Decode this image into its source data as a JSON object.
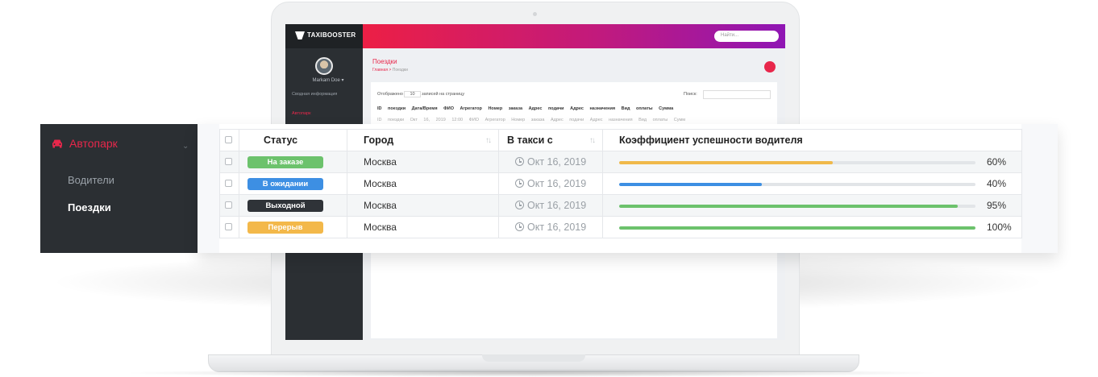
{
  "mini_app": {
    "brand": "TAXIBOOSTER",
    "user_name": "Markam Doe ▾",
    "menu": [
      "Сводная информация",
      "Автопарк"
    ],
    "search_placeholder": "Найти...",
    "page_title": "Поездки",
    "breadcrumb_home": "Главная",
    "breadcrumb_current": "Поездки",
    "show_prefix": "Отображено",
    "show_count": "10",
    "show_suffix": "записей на страницу",
    "search_label": "Поиск:",
    "columns": [
      "ID поездки",
      "Дата/Время",
      "ФИО",
      "Агрегатор",
      "Номер заказа",
      "Адрес подачи",
      "Адрес назначения",
      "Вид оплаты",
      "Сумма"
    ],
    "row_preview": "ID поездки  Окт 16, 2019 12:00  ФИО  Агрегатор  Номер заказа  Адрес подачи  Адрес назначения  Вид оплаты  Сумм"
  },
  "sidebar": {
    "parent_label": "Автопарк",
    "items": [
      {
        "label": "Водители"
      },
      {
        "label": "Поездки"
      }
    ]
  },
  "table": {
    "headers": {
      "status": "Статус",
      "city": "Город",
      "since": "В такси с",
      "rating": "Коэффициент успешности водителя"
    },
    "sort_glyph": "↑↓",
    "rows": [
      {
        "status": "На заказе",
        "status_color": "#6cc26c",
        "city": "Москва",
        "since": "Окт 16, 2019",
        "pct": 60,
        "pct_label": "60%",
        "bar_color": "#f0b94a"
      },
      {
        "status": "В ожидании",
        "status_color": "#3d8fe3",
        "city": "Москва",
        "since": "Окт 16, 2019",
        "pct": 40,
        "pct_label": "40%",
        "bar_color": "#3d8fe3"
      },
      {
        "status": "Выходной",
        "status_color": "#2f3338",
        "city": "Москва",
        "since": "Окт 16, 2019",
        "pct": 95,
        "pct_label": "95%",
        "bar_color": "#6cc26c"
      },
      {
        "status": "Перерыв",
        "status_color": "#f3b84a",
        "city": "Москва",
        "since": "Окт 16, 2019",
        "pct": 100,
        "pct_label": "100%",
        "bar_color": "#6cc26c"
      }
    ]
  },
  "colors": {
    "accent": "#e8274b",
    "sidebar_bg": "#2b2f33"
  },
  "icons": [
    "car-icon",
    "chevron-down-icon",
    "clock-icon",
    "sort-icon",
    "checkbox-icon"
  ]
}
